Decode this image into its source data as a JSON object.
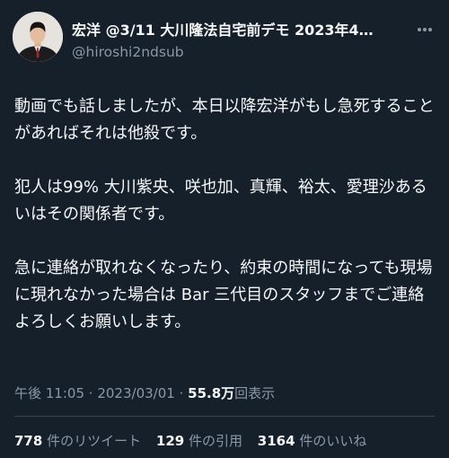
{
  "user": {
    "display_name": "宏洋 @3/11 大川隆法自宅前デモ 2023年4…",
    "handle": "@hiroshi2ndsub"
  },
  "icons": {
    "more": "more-horizontal-icon"
  },
  "tweet": {
    "paragraphs": [
      "動画でも話しましたが、本日以降宏洋がもし急死することがあればそれは他殺です。",
      "犯人は99% 大川紫央、咲也加、真輝、裕太、愛理沙あるいはその関係者です。",
      "急に連絡が取れなくなったり、約束の時間になっても現場に現れなかった場合は Bar 三代目のスタッフまでご連絡よろしくお願いします。"
    ]
  },
  "meta": {
    "time": "午後 11:05",
    "separator": "·",
    "date": "2023/03/01",
    "views_count": "55.8万",
    "views_label": "回表示"
  },
  "stats": {
    "retweets_count": "778",
    "retweets_label": "件のリツイート",
    "quotes_count": "129",
    "quotes_label": "件の引用",
    "likes_count": "3164",
    "likes_label": "件のいいね"
  },
  "colors": {
    "background": "#15202b",
    "primary_text": "#f7f9f9",
    "secondary_text": "#8b98a5",
    "divider": "#38444d"
  }
}
